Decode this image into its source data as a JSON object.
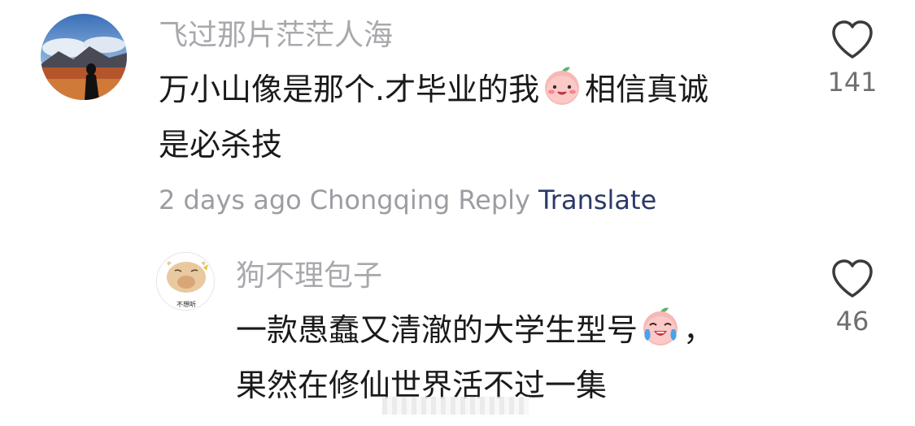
{
  "comments": [
    {
      "username": "飞过那片茫茫人海",
      "line1_before_emoji": "万小山像是那个.才毕业的我",
      "emoji": "smiling-peach-emoji",
      "line1_after_emoji": "相信真诚",
      "line2": "是必杀技",
      "time": "2 days ago",
      "location": "Chongqing",
      "reply_label": "Reply",
      "translate_label": "Translate",
      "likes": "141"
    },
    {
      "username": "狗不理包子",
      "avatar_text": "不想听",
      "line1_before_emoji": "一款愚蠢又清澈的大学生型号",
      "emoji": "crying-laughing-peach-emoji",
      "line1_after_emoji": "，",
      "line2": "果然在修仙世界活不过一集",
      "likes": "46"
    }
  ]
}
